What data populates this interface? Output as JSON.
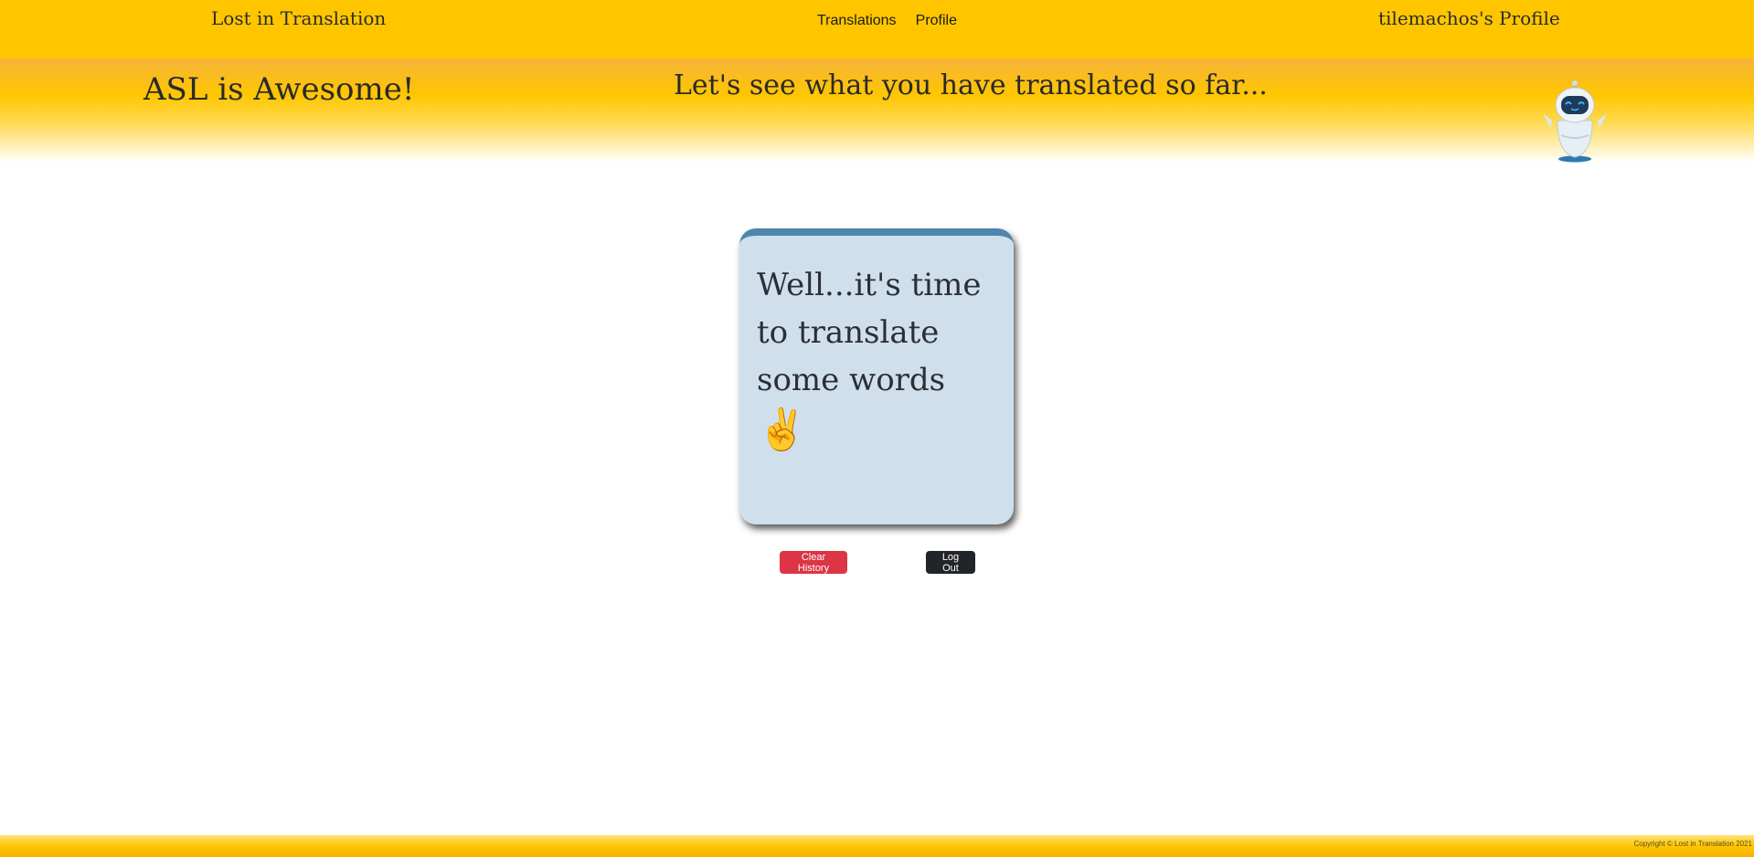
{
  "navbar": {
    "brand": "Lost in Translation",
    "links": [
      "Translations",
      "Profile"
    ],
    "user_profile": "tilemachos's Profile"
  },
  "header": {
    "tagline": "ASL is Awesome!",
    "subtitle": "Let's see what you have translated so far..."
  },
  "card": {
    "text": "Well...it's time to translate some words",
    "emoji": "✌️"
  },
  "actions": {
    "clear_history_label": "Clear History",
    "log_out_label": "Log Out"
  },
  "footer": {
    "copyright": "Copyright © Lost in Translation 2021"
  },
  "icons": {
    "logo": "robot-logo-icon"
  },
  "colors": {
    "primary_yellow": "#ffc600",
    "card_bg": "#cfe0ec",
    "card_accent": "#4e86ad",
    "danger": "#dc3545",
    "dark": "#212529"
  }
}
